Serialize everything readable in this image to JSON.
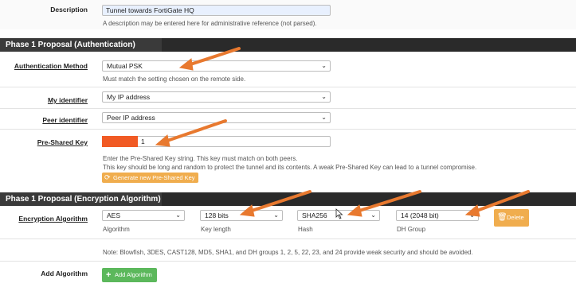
{
  "top": {
    "description_label": "Description",
    "description_value": "Tunnel towards FortiGate HQ",
    "description_help": "A description may be entered here for administrative reference (not parsed)."
  },
  "phase1_auth": {
    "title": "Phase 1 Proposal (Authentication)",
    "auth_method_label": "Authentication Method",
    "auth_method_value": "Mutual PSK",
    "auth_method_help": "Must match the setting chosen on the remote side.",
    "my_identifier_label": "My identifier",
    "my_identifier_value": "My IP address",
    "peer_identifier_label": "Peer identifier",
    "peer_identifier_value": "Peer IP address",
    "psk_label": "Pre-Shared Key",
    "psk_value": "1",
    "psk_help1": "Enter the Pre-Shared Key string. This key must match on both peers.",
    "psk_help2": "This key should be long and random to protect the tunnel and its contents. A weak Pre-Shared Key can lead to a tunnel compromise.",
    "generate_button": "Generate new Pre-Shared Key"
  },
  "phase1_enc": {
    "title": "Phase 1 Proposal (Encryption Algorithm)",
    "enc_label": "Encryption Algorithm",
    "algorithm_value": "AES",
    "algorithm_caption": "Algorithm",
    "keylength_value": "128 bits",
    "keylength_caption": "Key length",
    "hash_value": "SHA256",
    "hash_caption": "Hash",
    "dh_value": "14 (2048 bit)",
    "dh_caption": "DH Group",
    "delete_button": "Delete",
    "note": "Note: Blowfish, 3DES, CAST128, MD5, SHA1, and DH groups 1, 2, 5, 22, 23, and 24 provide weak security and should be avoided.",
    "add_label": "Add Algorithm",
    "add_button": "Add Algorithm"
  },
  "colors": {
    "header": "#3a3a3a",
    "annotation_arrow": "#e8792f",
    "warning_button": "#f0ad4e",
    "success_button": "#5cb85c",
    "redaction": "#f15a24"
  },
  "icons": {
    "dropdown": "chevron-down-icon",
    "refresh": "refresh-icon",
    "trash": "trash-icon",
    "plus": "plus-icon",
    "cursor": "mouse-cursor-icon"
  }
}
